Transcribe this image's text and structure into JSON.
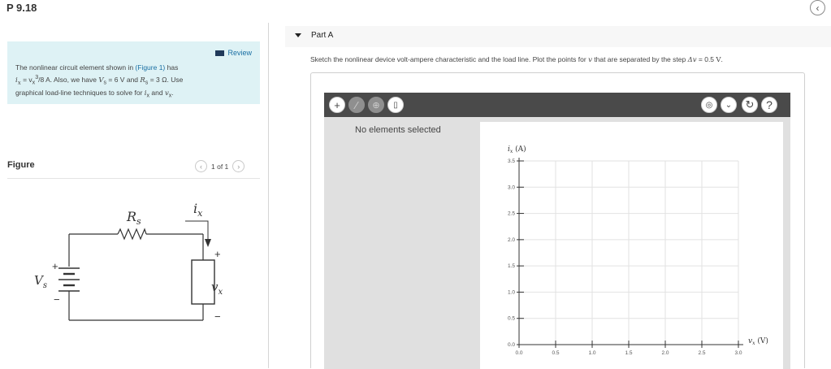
{
  "header": {
    "problem_id": "P 9.18",
    "back_icon": "chevron-left-icon"
  },
  "review": {
    "label": "Review",
    "text_a": "The nonlinear circuit element shown in ",
    "figure_link": "(Figure 1)",
    "text_b": " has",
    "eq1": "i",
    "eq1_sub": "x",
    "eq1_rest": " = v",
    "eq1_sub2": "x",
    "eq1_sup": "3",
    "eq1_end": "/8 A",
    "text_c": ". Also, we have ",
    "vs_val": "V",
    "vs_sub": "s",
    "vs_eq": " = 6 V",
    "and": " and ",
    "rs_val": "R",
    "rs_sub": "s",
    "rs_eq": " = 3 Ω",
    "text_d": ". Use",
    "text_e": "graphical load-line techniques to solve for ",
    "ix": "i",
    "ix_sub": "x",
    "text_f": " and ",
    "vx": "v",
    "vx_sub": "x",
    "text_g": "."
  },
  "figure": {
    "label": "Figure",
    "pager": "1 of 1",
    "circuit": {
      "rs_label": "R",
      "rs_sub": "s",
      "ix_label": "i",
      "ix_sub": "x",
      "vs_label": "V",
      "vs_sub": "s",
      "vx_label": "v",
      "vx_sub": "x",
      "plus": "+",
      "minus": "−"
    }
  },
  "part": {
    "title": "Part A",
    "instruction_a": "Sketch the nonlinear device volt-ampere characteristic and the load line. Plot the points for ",
    "instruction_v": "v",
    "instruction_b": " that are separated by the step ",
    "instruction_dv": "Δv",
    "instruction_c": " = 0.5 ",
    "instruction_unit": "V",
    "instruction_d": "."
  },
  "tool": {
    "tools_left": [
      {
        "name": "add-point-tool",
        "icon": "plus-icon",
        "glyph": "+"
      },
      {
        "name": "remove-tool",
        "icon": "slash-icon",
        "glyph": "⁄"
      },
      {
        "name": "add-vector-tool",
        "icon": "plus-arrow-icon",
        "glyph": "⊕"
      },
      {
        "name": "delete-tool",
        "icon": "trash-icon",
        "glyph": "🗑"
      }
    ],
    "tools_right": [
      {
        "name": "hint-tool",
        "icon": "lightbulb-icon",
        "glyph": "💡"
      },
      {
        "name": "more-tool",
        "icon": "chevron-down-icon",
        "glyph": "⌄"
      },
      {
        "name": "reset-tool",
        "icon": "reset-icon",
        "glyph": "↻"
      },
      {
        "name": "help-tool",
        "icon": "help-icon",
        "glyph": "?"
      }
    ],
    "empty_message": "No elements selected"
  },
  "chart_data": {
    "type": "scatter",
    "ylabel": "i",
    "ylabel_sub": "x",
    "ylabel_unit": "(A)",
    "xlabel": "v",
    "xlabel_sub": "x",
    "xlabel_unit": "(V)",
    "xlim": [
      0,
      3.0
    ],
    "ylim": [
      0,
      3.5
    ],
    "xticks": [
      "0.0",
      "0.5",
      "1.0",
      "1.5",
      "2.0",
      "2.5",
      "3.0"
    ],
    "yticks": [
      "0.0",
      "0.5",
      "1.0",
      "1.5",
      "2.0",
      "2.5",
      "3.0",
      "3.5"
    ],
    "grid": true,
    "series": []
  },
  "colors": {
    "review_bg": "#def2f5",
    "link": "#1a6fa3",
    "toolbar": "#4a4a4a",
    "grid": "#e2e2e2"
  }
}
